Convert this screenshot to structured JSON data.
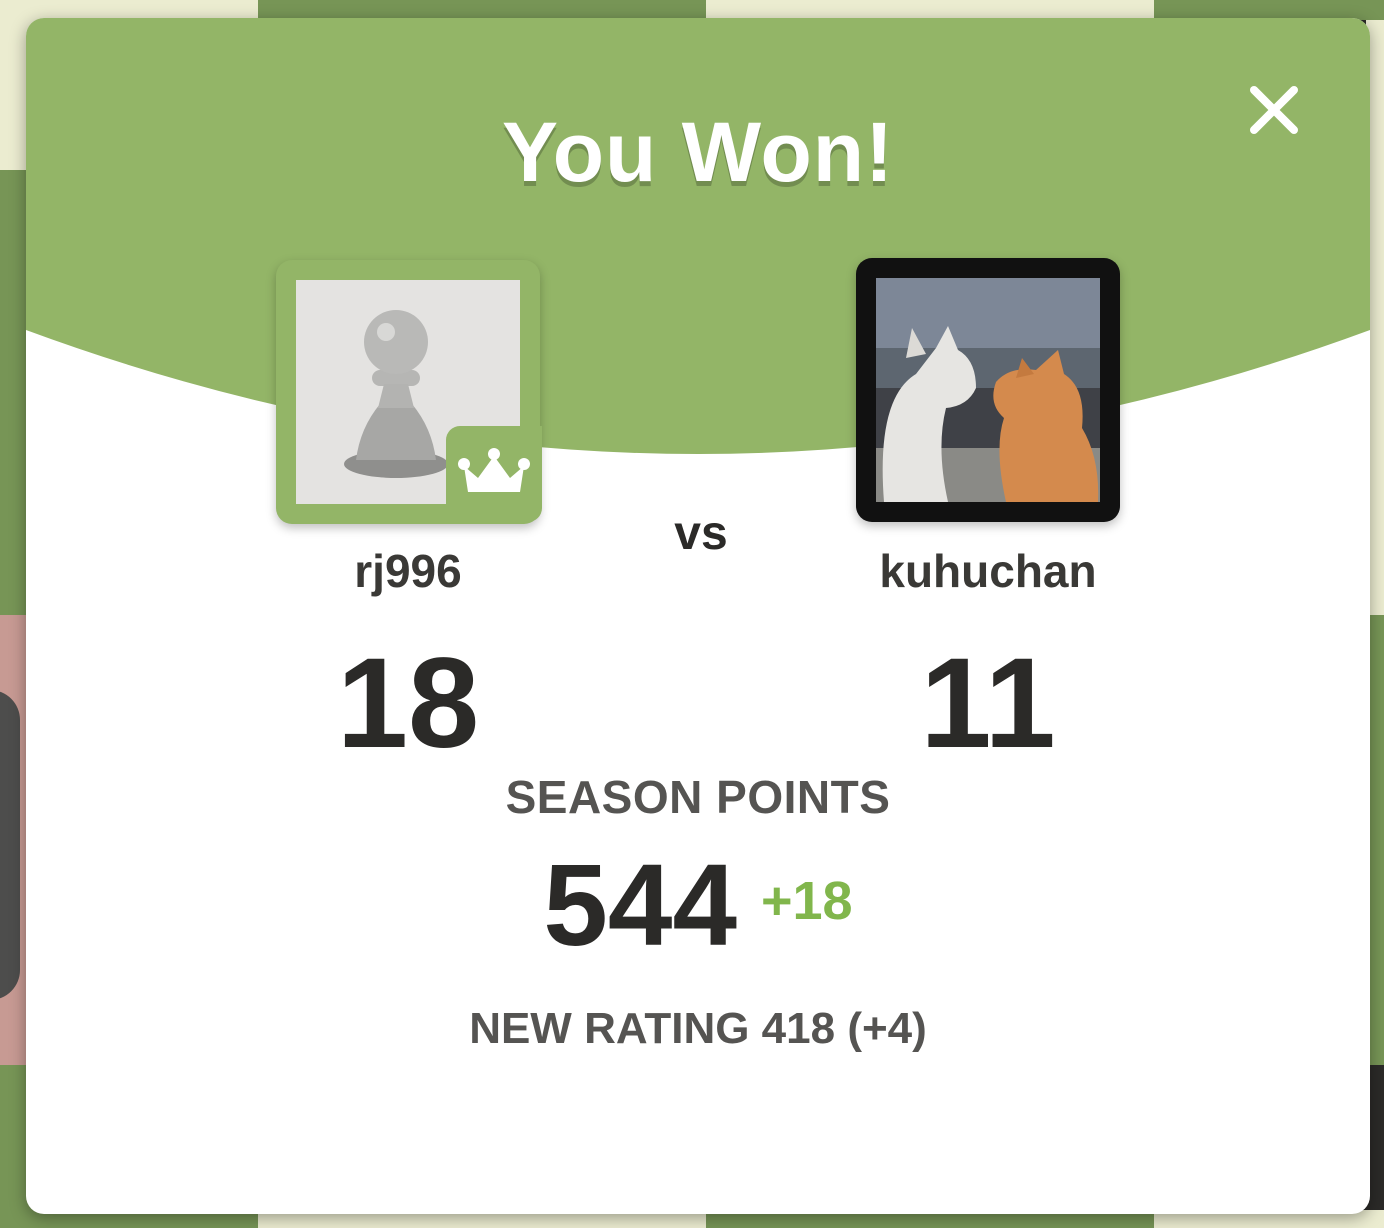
{
  "modal": {
    "title": "You Won!",
    "close_icon": "close-icon"
  },
  "players": {
    "left": {
      "username": "rj996",
      "score": "18",
      "avatar_icon": "pawn-avatar-icon",
      "badge_icon": "crown-icon"
    },
    "right": {
      "username": "kuhuchan",
      "score": "11",
      "avatar_icon": "cats-photo-avatar"
    },
    "vs_label": "vs"
  },
  "season": {
    "label": "SEASON POINTS",
    "value": "544",
    "delta": "+18"
  },
  "rating": {
    "text": "NEW RATING 418 (+4)"
  },
  "colors": {
    "header_green": "#93b567",
    "delta_green": "#81b64c",
    "text_dark": "#2b2a28",
    "text_gray": "#555452"
  }
}
